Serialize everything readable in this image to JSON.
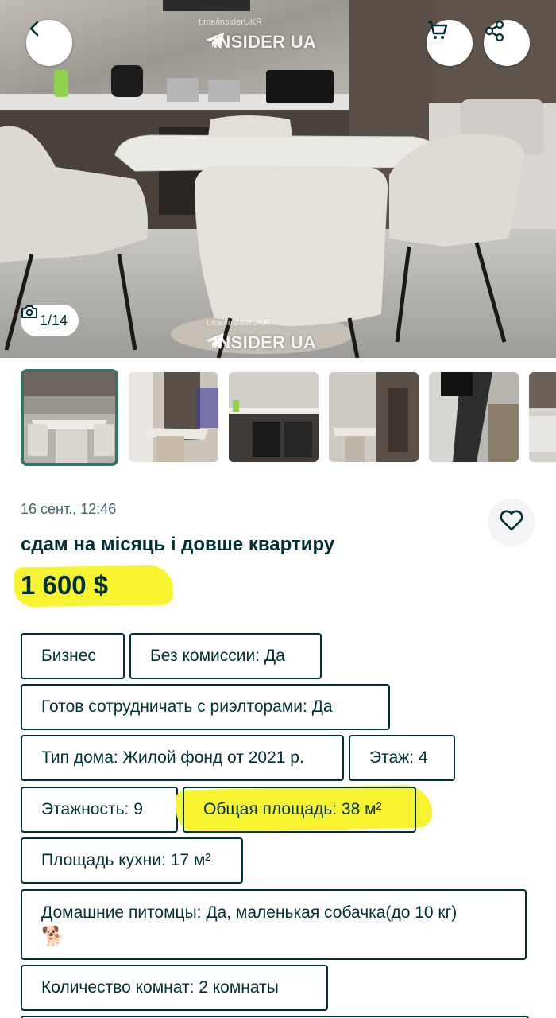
{
  "hero": {
    "counter": "1/14",
    "watermark_top": "INSIDER UA",
    "watermark_bottom": "INSIDER UA",
    "watermark_small": "t.me/insiderUKR"
  },
  "thumbnails": [
    {
      "name": "thumb-kitchen",
      "active": true
    },
    {
      "name": "thumb-living"
    },
    {
      "name": "thumb-kitchen-2"
    },
    {
      "name": "thumb-dining"
    },
    {
      "name": "thumb-hallway"
    },
    {
      "name": "thumb-sofa"
    }
  ],
  "listing": {
    "date": "16 сент., 12:46",
    "title": "сдам на місяць і довше квартиру",
    "price": "1 600 $"
  },
  "params": {
    "business": "Бизнес",
    "no_commission": "Без комиссии: Да",
    "realtors": "Готов сотрудничать с риэлторами: Да",
    "house_type": "Тип дома: Жилой фонд от 2021 р.",
    "floor": "Этаж: 4",
    "floors_total": "Этажность: 9",
    "total_area": "Общая площадь: 38 м²",
    "kitchen_area": "Площадь кухни: 17 м²",
    "pets": "Домашние питомцы: Да, маленькая собачка(до 10 кг)",
    "pets_emoji": "🐕",
    "rooms": "Количество комнат: 2 комнаты"
  },
  "colors": {
    "text": "#002f34",
    "highlight": "#f8f331",
    "active_thumb_border": "#3b6f6a"
  }
}
